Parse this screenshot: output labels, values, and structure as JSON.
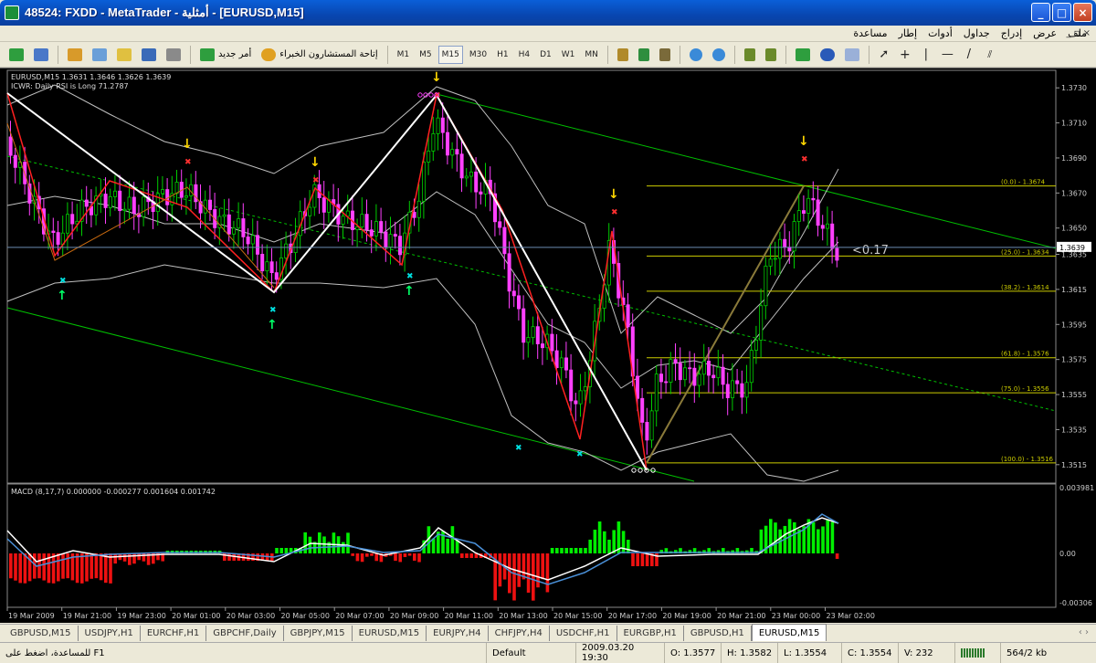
{
  "window": {
    "title": "48524: FXDD - MetaTrader - أمثلية - [EURUSD,M15]",
    "min": "_",
    "max": "□",
    "close": "×"
  },
  "menu": {
    "items": [
      "ملف",
      "عرض",
      "إدراج",
      "جداول",
      "أدوات",
      "إطار",
      "مساعدة"
    ],
    "mdi_controls": "_ ▫ ×"
  },
  "toolbar": {
    "new_order": "أمر جديد",
    "experts": "إتاحة المستشارون الخبراء",
    "timeframes": [
      "M1",
      "M5",
      "M15",
      "M30",
      "H1",
      "H4",
      "D1",
      "W1",
      "MN"
    ],
    "selected_timeframe": "M15"
  },
  "chart": {
    "header_line1": "EURUSD,M15 1.3631 1.3646 1.3626 1.3639",
    "header_line2": "ICWR: Daily RSI is Long 71.2787",
    "current_price": "1.3639",
    "price_axis": [
      "1.3730",
      "1.3710",
      "1.3690",
      "1.3670",
      "1.3650",
      "1.3635",
      "1.3615",
      "1.3595",
      "1.3575",
      "1.3555",
      "1.3535",
      "1.3515"
    ],
    "fib_labels": [
      "(0.0) - 1.3674",
      "(25.0) - 1.3634",
      "(38.2) - 1.3614",
      "(61.8) - 1.3576",
      "(75.0) - 1.3556",
      "(100.0) - 1.3516"
    ],
    "fib_ratio_label": "<0.17",
    "macd_label": "MACD (8,17,7) 0.000000 -0.000277 0.001604 0.001742",
    "macd_axis": [
      "0.003981",
      "0.00",
      "-0.00306"
    ],
    "time_axis": [
      "19 Mar 2009",
      "19 Mar 21:00",
      "19 Mar 23:00",
      "20 Mar 01:00",
      "20 Mar 03:00",
      "20 Mar 05:00",
      "20 Mar 07:00",
      "20 Mar 09:00",
      "20 Mar 11:00",
      "20 Mar 13:00",
      "20 Mar 15:00",
      "20 Mar 17:00",
      "20 Mar 19:00",
      "20 Mar 21:00",
      "23 Mar 00:00",
      "23 Mar 02:00"
    ],
    "colors": {
      "bull": "#00cc00",
      "bear": "#ff40ff",
      "zigzag": "#ffffff",
      "channel": "#00c000",
      "fib": "#cccc00",
      "macd_up": "#00ee00",
      "macd_down": "#ee1111",
      "bands": "#c0c0c0"
    }
  },
  "tabs": [
    "GBPUSD,M15",
    "USDJPY,H1",
    "EURCHF,H1",
    "GBPCHF,Daily",
    "GBPJPY,M15",
    "EURUSD,M15",
    "EURJPY,H4",
    "CHFJPY,H4",
    "USDCHF,H1",
    "EURGBP,H1",
    "GBPUSD,H1",
    "EURUSD,M15"
  ],
  "tabs_nav": "‹ ›",
  "status": {
    "help": "للمساعدة، اضغط على F1",
    "profile": "Default",
    "datetime": "2009.03.20 19:30",
    "open": "O: 1.3577",
    "high": "H: 1.3582",
    "low": "L: 1.3554",
    "close": "C: 1.3554",
    "volume": "V: 232",
    "traffic": "564/2 kb"
  }
}
